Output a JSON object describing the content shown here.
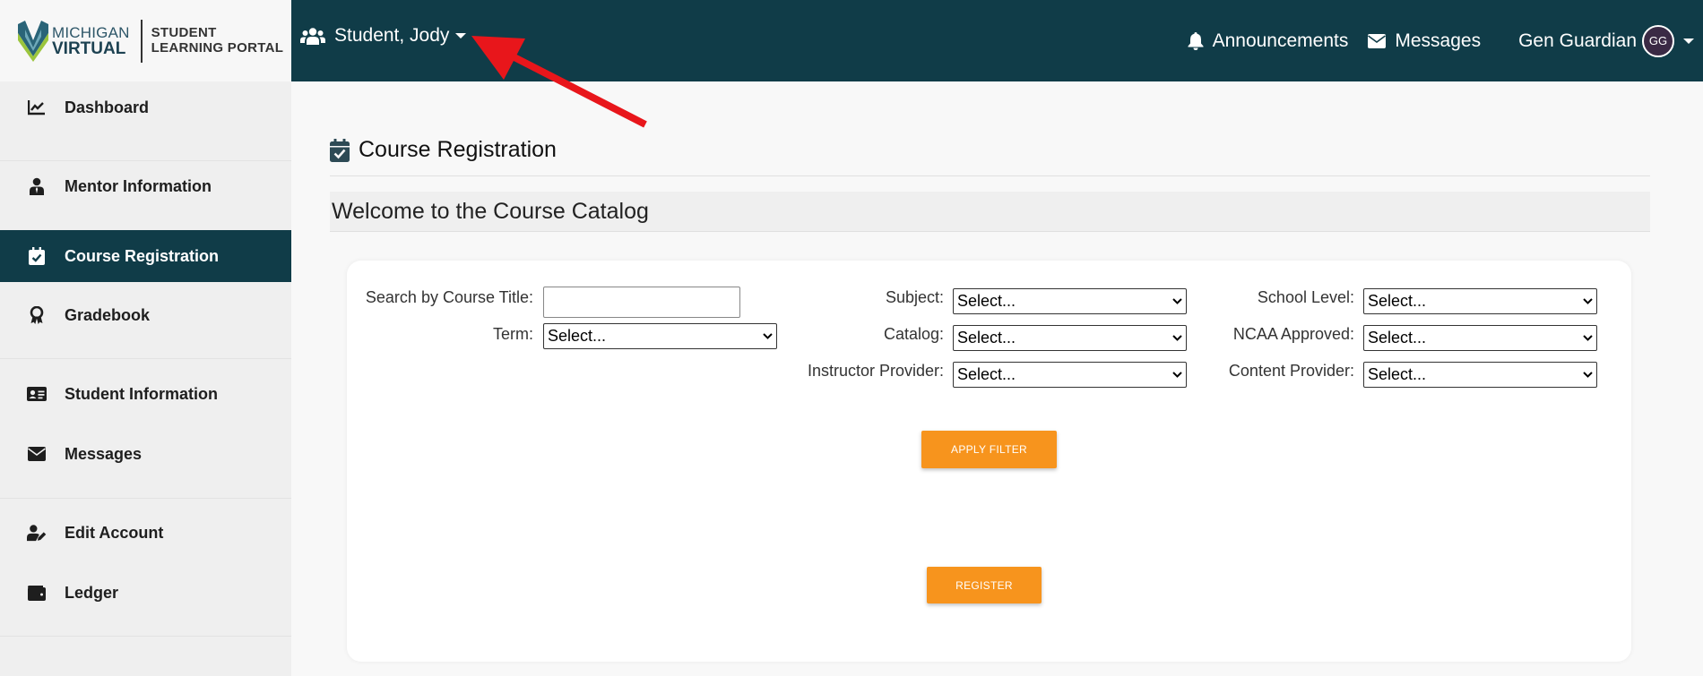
{
  "brand": {
    "michigan": "MICHIGAN",
    "virtual": "VIRTUAL",
    "portal_line1": "STUDENT",
    "portal_line2": "LEARNING PORTAL"
  },
  "sidebar": {
    "items": [
      {
        "label": "Dashboard",
        "icon": "chart-line-icon",
        "active": false
      },
      {
        "label": "Mentor Information",
        "icon": "user-tie-icon",
        "active": false
      },
      {
        "label": "Course Registration",
        "icon": "calendar-check-icon",
        "active": true
      },
      {
        "label": "Gradebook",
        "icon": "award-icon",
        "active": false
      },
      {
        "label": "Student Information",
        "icon": "id-card-icon",
        "active": false
      },
      {
        "label": "Messages",
        "icon": "envelope-icon",
        "active": false
      },
      {
        "label": "Edit Account",
        "icon": "user-edit-icon",
        "active": false
      },
      {
        "label": "Ledger",
        "icon": "wallet-icon",
        "active": false
      }
    ]
  },
  "topbar": {
    "student_name": "Student, Jody",
    "announcements": "Announcements",
    "messages": "Messages",
    "guardian_name": "Gen Guardian",
    "avatar_initials": "GG"
  },
  "main": {
    "page_title": "Course Registration",
    "welcome": "Welcome to the Course Catalog"
  },
  "filters": {
    "search_label": "Search by Course Title:",
    "search_value": "",
    "term_label": "Term:",
    "term_value": "Select...",
    "subject_label": "Subject:",
    "subject_value": "Select...",
    "catalog_label": "Catalog:",
    "catalog_value": "Select...",
    "instructor_label": "Instructor Provider:",
    "instructor_value": "Select...",
    "school_level_label": "School Level:",
    "school_level_value": "Select...",
    "ncaa_label": "NCAA Approved:",
    "ncaa_value": "Select...",
    "content_label": "Content Provider:",
    "content_value": "Select...",
    "apply_label": "APPLY FILTER",
    "register_label": "REGISTER"
  },
  "colors": {
    "primary_dark": "#103c48",
    "accent_orange": "#f7941d",
    "annotation_red": "#e8161b"
  }
}
